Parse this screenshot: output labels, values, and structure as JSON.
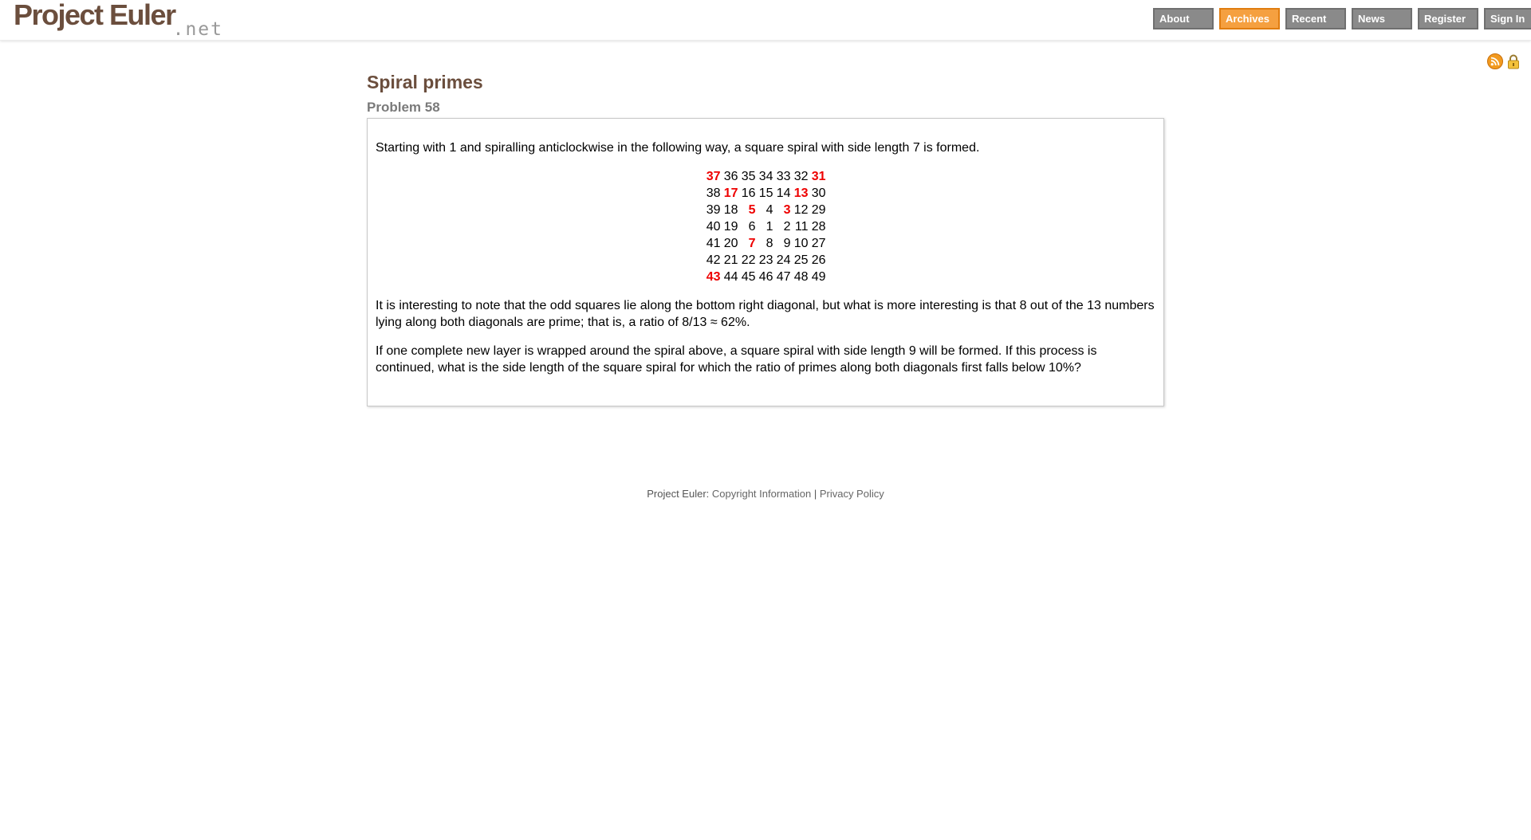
{
  "header": {
    "logo_text": "Project Euler",
    "logo_suffix": ".net",
    "nav": [
      {
        "label": "About",
        "active": false
      },
      {
        "label": "Archives",
        "active": true
      },
      {
        "label": "Recent",
        "active": false
      },
      {
        "label": "News",
        "active": false
      },
      {
        "label": "Register",
        "active": false
      },
      {
        "label": "Sign In",
        "active": false
      }
    ]
  },
  "icons": [
    "rss-feed-icon",
    "lock-icon"
  ],
  "colors": {
    "brand": "#6b4e3d",
    "active_tab": "#f5a040",
    "tab": "#8a8a8a",
    "prime": "#e00000"
  },
  "problem": {
    "title": "Spiral primes",
    "number_label": "Problem 58",
    "intro": "Starting with 1 and spiralling anticlockwise in the following way, a square spiral with side length 7 is formed.",
    "spiral": [
      [
        {
          "v": "37",
          "p": true
        },
        {
          "v": "36"
        },
        {
          "v": "35"
        },
        {
          "v": "34"
        },
        {
          "v": "33"
        },
        {
          "v": "32"
        },
        {
          "v": "31",
          "p": true
        }
      ],
      [
        {
          "v": "38"
        },
        {
          "v": "17",
          "p": true
        },
        {
          "v": "16"
        },
        {
          "v": "15"
        },
        {
          "v": "14"
        },
        {
          "v": "13",
          "p": true
        },
        {
          "v": "30"
        }
      ],
      [
        {
          "v": "39"
        },
        {
          "v": "18"
        },
        {
          "v": "5",
          "p": true
        },
        {
          "v": "4"
        },
        {
          "v": "3",
          "p": true
        },
        {
          "v": "12"
        },
        {
          "v": "29"
        }
      ],
      [
        {
          "v": "40"
        },
        {
          "v": "19"
        },
        {
          "v": "6"
        },
        {
          "v": "1"
        },
        {
          "v": "2"
        },
        {
          "v": "11"
        },
        {
          "v": "28"
        }
      ],
      [
        {
          "v": "41"
        },
        {
          "v": "20"
        },
        {
          "v": "7",
          "p": true
        },
        {
          "v": "8"
        },
        {
          "v": "9"
        },
        {
          "v": "10"
        },
        {
          "v": "27"
        }
      ],
      [
        {
          "v": "42"
        },
        {
          "v": "21"
        },
        {
          "v": "22"
        },
        {
          "v": "23"
        },
        {
          "v": "24"
        },
        {
          "v": "25"
        },
        {
          "v": "26"
        }
      ],
      [
        {
          "v": "43",
          "p": true
        },
        {
          "v": "44"
        },
        {
          "v": "45"
        },
        {
          "v": "46"
        },
        {
          "v": "47"
        },
        {
          "v": "48"
        },
        {
          "v": "49"
        }
      ]
    ],
    "paragraph2": "It is interesting to note that the odd squares lie along the bottom right diagonal, but what is more interesting is that 8 out of the 13 numbers lying along both diagonals are prime; that is, a ratio of 8/13 ≈ 62%.",
    "paragraph3": "If one complete new layer is wrapped around the spiral above, a square spiral with side length 9 will be formed. If this process is continued, what is the side length of the square spiral for which the ratio of primes along both diagonals first falls below 10%?"
  },
  "footer": {
    "prefix": "Project Euler:",
    "copyright": "Copyright Information",
    "separator": "|",
    "privacy": "Privacy Policy"
  }
}
